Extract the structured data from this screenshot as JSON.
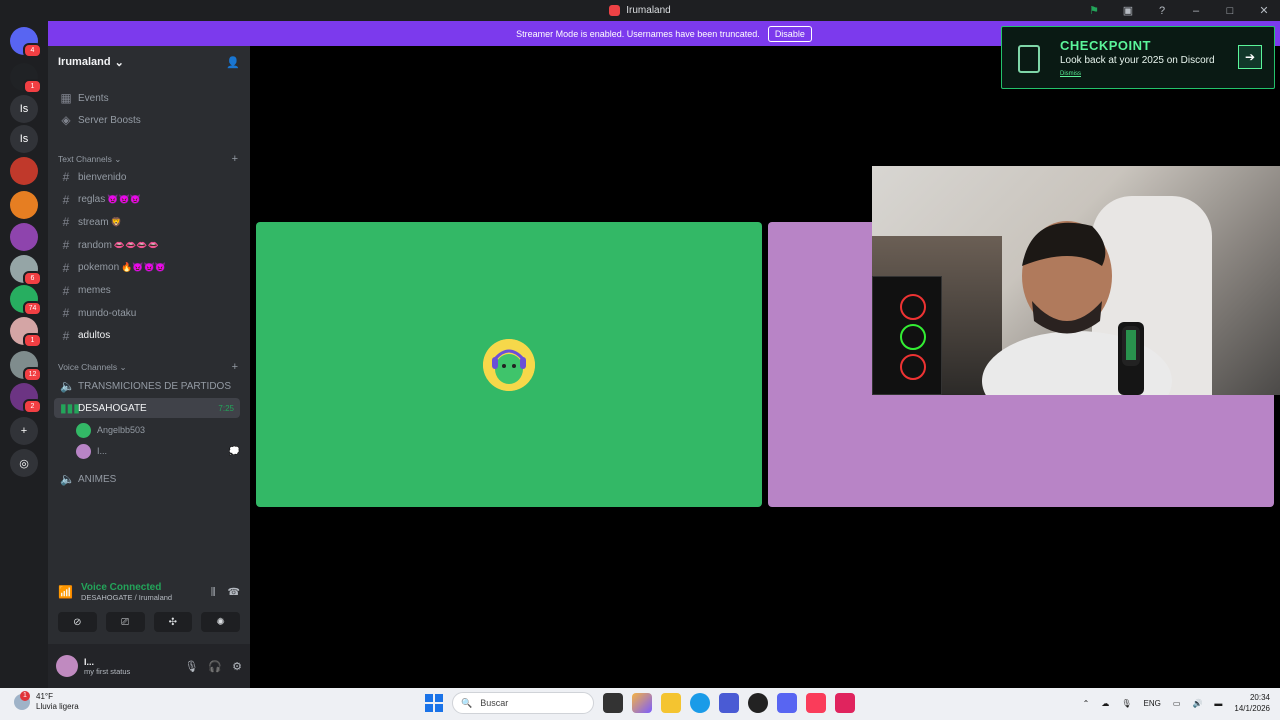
{
  "window": {
    "title": "Irumaland"
  },
  "servers": [
    {
      "label": "",
      "badge": "4",
      "color": "#5865f2",
      "icon": "discord-logo-icon"
    },
    {
      "label": "",
      "badge": "1",
      "color": "#202225",
      "icon": "server-icon"
    },
    {
      "label": "Is",
      "badge": "",
      "color": "#313338",
      "icon": ""
    },
    {
      "label": "Is",
      "badge": "",
      "color": "#313338",
      "icon": ""
    },
    {
      "label": "",
      "badge": "",
      "color": "#c0392b",
      "icon": "server-icon"
    },
    {
      "label": "",
      "badge": "",
      "color": "#e67e22",
      "icon": "server-icon"
    },
    {
      "label": "",
      "badge": "",
      "color": "#8e44ad",
      "icon": "server-icon"
    },
    {
      "label": "",
      "badge": "6",
      "color": "#95a5a6",
      "icon": "server-icon"
    },
    {
      "label": "",
      "badge": "74",
      "color": "#27ae60",
      "icon": "server-icon"
    },
    {
      "label": "",
      "badge": "1",
      "color": "#d4a5a5",
      "icon": "server-icon"
    },
    {
      "label": "",
      "badge": "12",
      "color": "#7f8c8d",
      "icon": "server-icon"
    },
    {
      "label": "",
      "badge": "2",
      "color": "#6c3483",
      "icon": "server-icon"
    }
  ],
  "banner": {
    "text": "Streamer Mode is enabled. Usernames have been truncated.",
    "disable_label": "Disable"
  },
  "guild": {
    "name": "Irumaland"
  },
  "top_items": [
    {
      "label": "Events"
    },
    {
      "label": "Server Boosts"
    }
  ],
  "text_category": {
    "label": "Text Channels"
  },
  "text_channels": [
    {
      "name": "bienvenido",
      "emoji": ""
    },
    {
      "name": "reglas",
      "emoji": "👿👿👿"
    },
    {
      "name": "stream",
      "emoji": "🦁"
    },
    {
      "name": "random",
      "emoji": "👄👄👄👄"
    },
    {
      "name": "pokemon",
      "emoji": "🔥👿👿👿"
    },
    {
      "name": "memes",
      "emoji": ""
    },
    {
      "name": "mundo-otaku",
      "emoji": ""
    },
    {
      "name": "adultos",
      "emoji": ""
    }
  ],
  "voice_category": {
    "label": "Voice Channels"
  },
  "voice_channels": [
    {
      "name": "TRANSMICIONES DE PARTIDOS"
    },
    {
      "name": "DESAHOGATE",
      "time": "7:25"
    },
    {
      "name": "ANIMES"
    }
  ],
  "voice_users": [
    {
      "name": "Angelbb503",
      "color": "#33b866"
    },
    {
      "name": "I...",
      "color": "#b884c6"
    }
  ],
  "voice_connection": {
    "title": "Voice Connected",
    "subtitle": "DESAHOGATE / Irumaland"
  },
  "user": {
    "name": "I...",
    "status": "my first status"
  },
  "checkpoint": {
    "title": "CHECKPOINT",
    "subtitle": "Look back at your 2025 on Discord",
    "dismiss": "Dismiss"
  },
  "taskbar": {
    "temp": "41°F",
    "weather": "Lluvia ligera",
    "weather_badge": "1",
    "search_placeholder": "Buscar",
    "lang": "ENG",
    "time": "20:34",
    "date": "14/1/2026"
  },
  "colors": {
    "accent_green": "#23a55a",
    "banner_purple": "#7c3aed",
    "tile_green": "#33b866",
    "tile_pink": "#b884c6"
  }
}
